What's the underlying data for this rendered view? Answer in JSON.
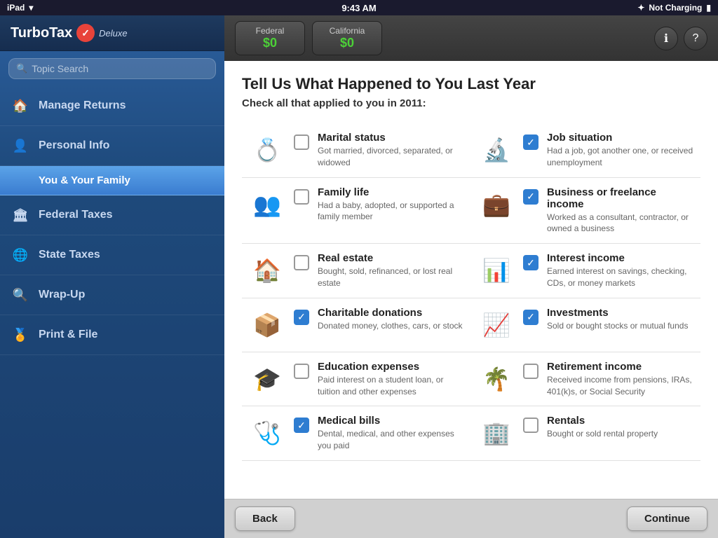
{
  "statusBar": {
    "left": "iPad",
    "time": "9:43 AM",
    "right": "Not Charging"
  },
  "sidebar": {
    "logo": "TurboTax",
    "logoCheck": "✓",
    "logoDeluxe": "Deluxe",
    "search": {
      "placeholder": "Topic Search"
    },
    "items": [
      {
        "id": "manage-returns",
        "label": "Manage Returns",
        "icon": "🏠"
      },
      {
        "id": "personal-info",
        "label": "Personal Info",
        "icon": "👤"
      },
      {
        "id": "you-family",
        "label": "You & Your Family",
        "sub": true
      },
      {
        "id": "federal-taxes",
        "label": "Federal Taxes",
        "icon": "🏛"
      },
      {
        "id": "state-taxes",
        "label": "State Taxes",
        "icon": "🌐"
      },
      {
        "id": "wrap-up",
        "label": "Wrap-Up",
        "icon": "🔍"
      },
      {
        "id": "print-file",
        "label": "Print & File",
        "icon": "🏅"
      }
    ]
  },
  "tabs": {
    "federal": {
      "label": "Federal",
      "amount": "$0"
    },
    "california": {
      "label": "California",
      "amount": "$0"
    }
  },
  "content": {
    "title": "Tell Us What Happened to You Last Year",
    "subtitle": "Check all that applied to you in 2011:",
    "items": [
      {
        "id": "marital-status",
        "icon": "💍",
        "checked": false,
        "title": "Marital status",
        "desc": "Got married, divorced, separated, or widowed"
      },
      {
        "id": "job-situation",
        "icon": "🔍",
        "checked": true,
        "title": "Job situation",
        "desc": "Had a job, got another one, or received unemployment"
      },
      {
        "id": "family-life",
        "icon": "👨‍👩‍👧",
        "checked": false,
        "title": "Family life",
        "desc": "Had a baby, adopted, or supported a family member"
      },
      {
        "id": "business-freelance",
        "icon": "💼",
        "checked": true,
        "title": "Business or freelance income",
        "desc": "Worked as a consultant, contractor, or owned a business"
      },
      {
        "id": "real-estate",
        "icon": "🏠",
        "checked": false,
        "title": "Real estate",
        "desc": "Bought, sold, refinanced, or lost real estate"
      },
      {
        "id": "interest-income",
        "icon": "🥧",
        "checked": true,
        "title": "Interest income",
        "desc": "Earned interest on savings, checking, CDs, or money markets"
      },
      {
        "id": "charitable-donations",
        "icon": "📦",
        "checked": true,
        "title": "Charitable donations",
        "desc": "Donated money, clothes, cars, or stock"
      },
      {
        "id": "investments",
        "icon": "📈",
        "checked": true,
        "title": "Investments",
        "desc": "Sold or bought stocks or mutual funds"
      },
      {
        "id": "education-expenses",
        "icon": "🎓",
        "checked": false,
        "title": "Education expenses",
        "desc": "Paid interest on a student loan, or tuition and other expenses"
      },
      {
        "id": "retirement-income",
        "icon": "⛱",
        "checked": false,
        "title": "Retirement income",
        "desc": "Received income from pensions, IRAs, 401(k)s, or Social Security"
      },
      {
        "id": "medical-bills",
        "icon": "🩺",
        "checked": true,
        "title": "Medical bills",
        "desc": "Dental, medical, and other expenses you paid"
      },
      {
        "id": "rentals",
        "icon": "🏢",
        "checked": false,
        "title": "Rentals",
        "desc": "Bought or sold rental property"
      }
    ]
  },
  "footer": {
    "back": "Back",
    "continue": "Continue"
  }
}
